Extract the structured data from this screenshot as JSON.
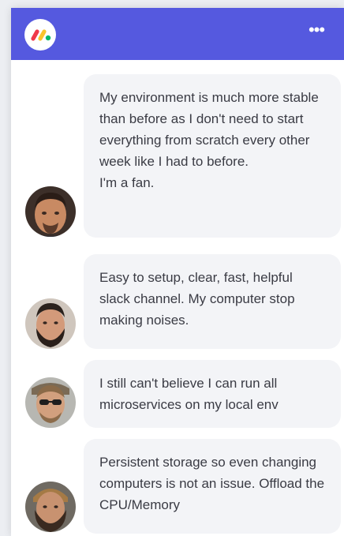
{
  "app": {
    "brand_colors": {
      "header": "#5559df",
      "logo_red": "#f0394a",
      "logo_yellow": "#f9c42d",
      "logo_green": "#00b86b"
    },
    "logo_icon": "monday-logo-icon",
    "menu_icon": "more-options-icon",
    "menu_glyph": "•••"
  },
  "messages": [
    {
      "text": "My environment is much more stable than before as I don't need to start everything from scratch every other week like I had to before.\nI'm a fan.",
      "avatar": "user-avatar-1"
    },
    {
      "text": "Easy to setup, clear, fast, helpful slack channel. My computer stop making noises.",
      "avatar": "user-avatar-2"
    },
    {
      "text": "I still can't believe I can run all microservices on my local env",
      "avatar": "user-avatar-3"
    },
    {
      "text": "Persistent storage so even changing computers is not an issue. Offload the CPU/Memory",
      "avatar": "user-avatar-4"
    }
  ]
}
